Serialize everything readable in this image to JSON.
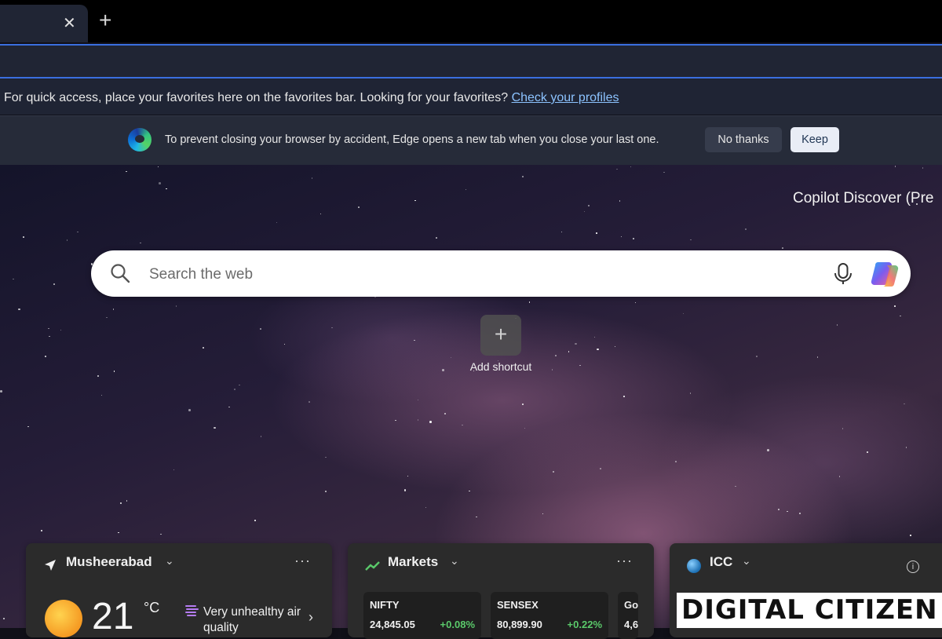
{
  "tabstrip": {
    "close_glyph": "✕",
    "new_tab_glyph": "+"
  },
  "favorites_bar": {
    "message": "For quick access, place your favorites here on the favorites bar. Looking for your favorites?",
    "link": "Check your profiles"
  },
  "info_bar": {
    "message": "To prevent closing your browser by accident, Edge opens a new tab when you close your last one.",
    "no_thanks": "No thanks",
    "keep": "Keep"
  },
  "copilot_discover": "Copilot Discover (Pre",
  "search": {
    "placeholder": "Search the web"
  },
  "shortcut": {
    "glyph": "+",
    "label": "Add shortcut"
  },
  "cards": {
    "weather": {
      "location": "Musheerabad",
      "temperature": "21",
      "unit": "°C",
      "air_quality": "Very unhealthy air quality",
      "more_glyph": "···"
    },
    "markets": {
      "title": "Markets",
      "more_glyph": "···",
      "tickers": [
        {
          "name": "NIFTY",
          "value": "24,845.05",
          "change": "+0.08%"
        },
        {
          "name": "SENSEX",
          "value": "80,899.90",
          "change": "+0.22%"
        },
        {
          "name": "Gol",
          "value": "4,6",
          "change": ""
        }
      ]
    },
    "icc": {
      "title": "ICC"
    }
  },
  "watermark": "DIGITAL CITIZEN"
}
